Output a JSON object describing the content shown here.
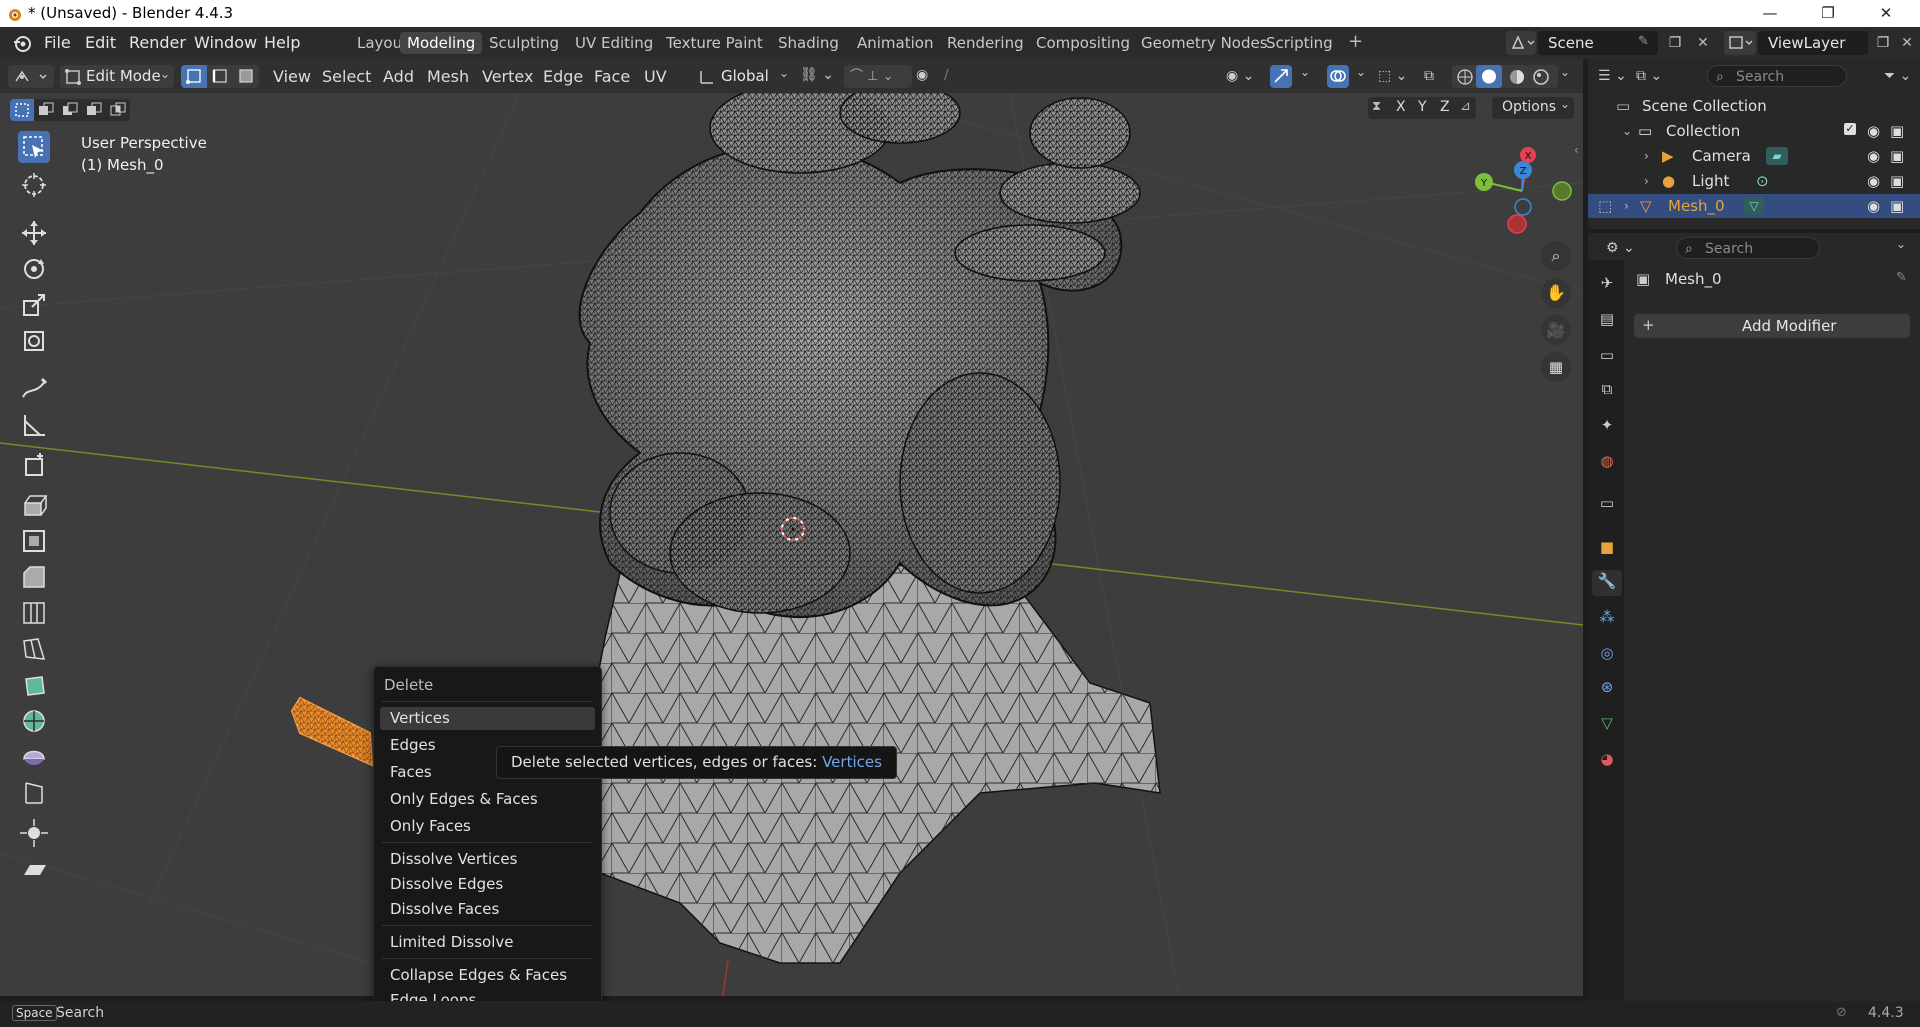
{
  "window": {
    "title": "* (Unsaved) - Blender 4.4.3",
    "min": "—",
    "max": "❐",
    "close": "✕"
  },
  "topmenu": [
    "File",
    "Edit",
    "Render",
    "Window",
    "Help"
  ],
  "workspaces": [
    "Layout",
    "Modeling",
    "Sculpting",
    "UV Editing",
    "Texture Paint",
    "Shading",
    "Animation",
    "Rendering",
    "Compositing",
    "Geometry Nodes",
    "Scripting"
  ],
  "active_workspace": "Modeling",
  "scene": {
    "name": "Scene",
    "view_layer": "ViewLayer"
  },
  "header": {
    "mode": "Edit Mode",
    "menus": [
      "View",
      "Select",
      "Add",
      "Mesh",
      "Vertex",
      "Edge",
      "Face",
      "UV"
    ],
    "orientation": "Global",
    "axes": [
      "X",
      "Y",
      "Z"
    ],
    "options": "Options"
  },
  "viewport": {
    "perspective": "User Perspective",
    "object": "(1) Mesh_0",
    "gizmo": {
      "x": "X",
      "y": "Y",
      "z": "Z"
    }
  },
  "delete_menu": {
    "title": "Delete",
    "group1": [
      "Vertices",
      "Edges",
      "Faces",
      "Only Edges & Faces",
      "Only Faces"
    ],
    "group2": [
      "Dissolve Vertices",
      "Dissolve Edges",
      "Dissolve Faces"
    ],
    "group3": [
      "Limited Dissolve"
    ],
    "group4": [
      "Collapse Edges & Faces",
      "Edge Loops"
    ],
    "highlighted": "Vertices"
  },
  "tooltip": {
    "text": "Delete selected vertices, edges or faces: ",
    "value": "Vertices"
  },
  "outliner": {
    "search_placeholder": "Search",
    "root": "Scene Collection",
    "collection": "Collection",
    "items": [
      "Camera",
      "Light",
      "Mesh_0"
    ],
    "selected": "Mesh_0"
  },
  "properties": {
    "search_placeholder": "Search",
    "object": "Mesh_0",
    "add_modifier": "Add Modifier"
  },
  "status": {
    "key": "Space",
    "action": "Search",
    "version": "4.4.3"
  },
  "colors": {
    "accent": "#4772b3",
    "selection": "#f08c28",
    "active_object": "#e9a23b",
    "x_axis": "#e84052",
    "y_axis": "#7bbf3a",
    "z_axis": "#3b86d8"
  }
}
